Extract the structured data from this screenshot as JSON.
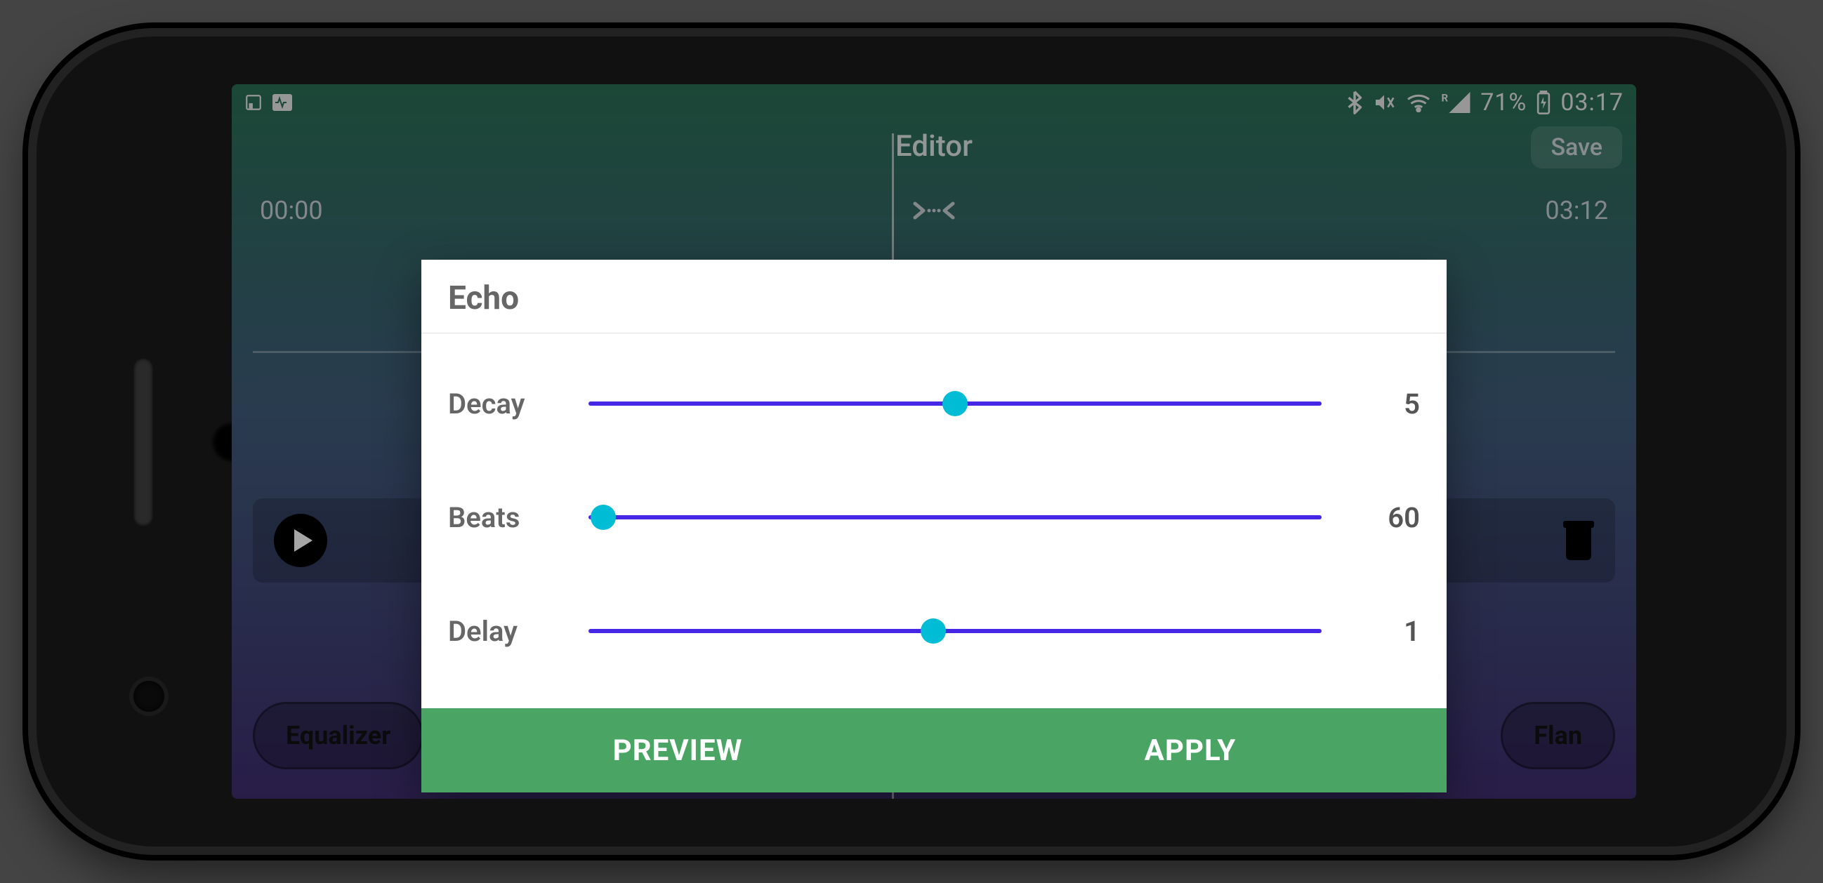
{
  "statusbar": {
    "battery_pct": "71%",
    "time": "03:17"
  },
  "appbar": {
    "title": "Editor",
    "save_label": "Save"
  },
  "timeline": {
    "start": "00:00",
    "end": "03:12"
  },
  "effects": {
    "chip_left": "Equalizer",
    "chip_right_partial": "Flan"
  },
  "dialog": {
    "title": "Echo",
    "sliders": [
      {
        "label": "Decay",
        "value": "5",
        "pos_pct": 50
      },
      {
        "label": "Beats",
        "value": "60",
        "pos_pct": 2
      },
      {
        "label": "Delay",
        "value": "1",
        "pos_pct": 47
      }
    ],
    "preview_label": "PREVIEW",
    "apply_label": "APPLY"
  },
  "colors": {
    "accent_green": "#4aa564",
    "slider_track": "#4527e5",
    "slider_thumb": "#00bcd4"
  }
}
